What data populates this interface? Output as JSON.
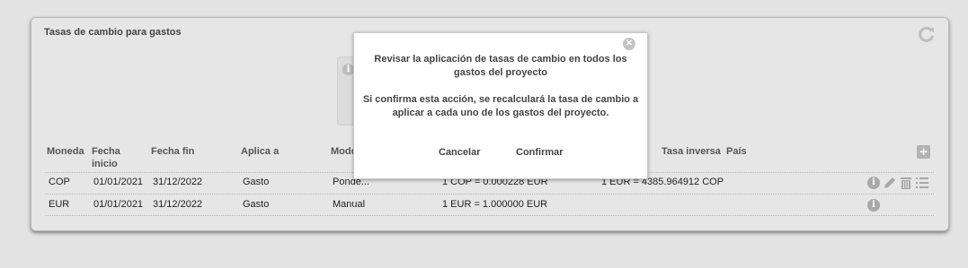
{
  "panel": {
    "title": "Tasas de cambio para gastos",
    "refresh_icon": "refresh-icon",
    "add_icon": "plus-icon",
    "ghost_info_icon": "info-icon"
  },
  "table": {
    "headers": {
      "moneda": "Moneda",
      "fecha_inicio": "Fecha inicio",
      "fecha_fin": "Fecha fin",
      "aplica_a": "Aplica a",
      "modo": "Modo",
      "tasa_inversa": "Tasa inversa",
      "pais": "País"
    },
    "rows": [
      {
        "moneda": "COP",
        "fecha_inicio": "01/01/2021",
        "fecha_fin": "31/12/2022",
        "aplica_a": "Gasto",
        "modo": "Ponde...",
        "tasa": "1 COP = 0.000228 EUR",
        "tasa_inversa": "1 EUR = 4385.964912 COP",
        "pais": "",
        "icons": [
          "info-icon",
          "edit-icon",
          "trash-icon",
          "list-icon"
        ]
      },
      {
        "moneda": "EUR",
        "fecha_inicio": "01/01/2021",
        "fecha_fin": "31/12/2022",
        "aplica_a": "Gasto",
        "modo": "Manual",
        "tasa": "1 EUR = 1.000000 EUR",
        "tasa_inversa": "",
        "pais": "",
        "icons": [
          "info-icon"
        ]
      }
    ]
  },
  "modal": {
    "close_icon": "close-icon",
    "title": "Revisar la aplicación de tasas de cambio en todos los gastos del proyecto",
    "message": "Si confirma esta acción, se recalculará la tasa de cambio a aplicar a cada uno de los gastos del proyecto.",
    "cancel_label": "Cancelar",
    "confirm_label": "Confirmar"
  },
  "colors": {
    "background": "#e3e3e3",
    "panel": "#e6e6e6",
    "icon_gray": "#a8a8a8",
    "modal_bg": "#ffffff"
  }
}
